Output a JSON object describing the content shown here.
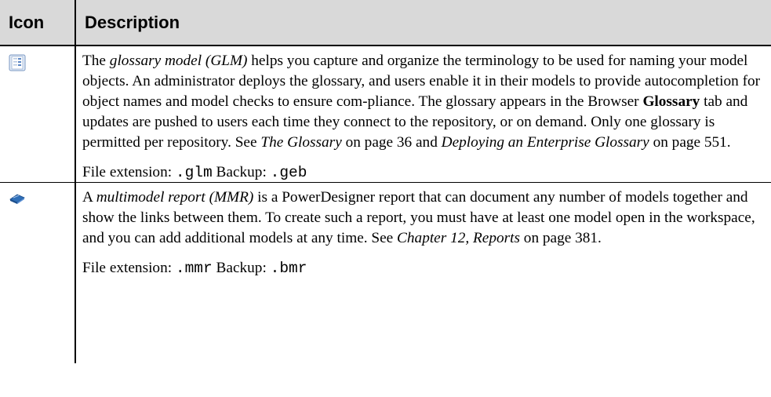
{
  "table": {
    "headers": {
      "icon": "Icon",
      "description": "Description"
    },
    "rows": [
      {
        "icon": "glossary-model-icon",
        "seg": [
          "The ",
          "glossary model (GLM)",
          " helps you capture and organize the terminology to be used for naming your model objects. An administrator deploys the glossary, and users enable it in their models to provide autocompletion for object names and model checks to ensure com-pliance. The glossary appears in the Browser ",
          "Glossary",
          " tab and updates are pushed to users each time they connect to the repository, or on demand. Only one glossary is permitted per repository. See ",
          "The Glossary",
          " on page 36 and ",
          "Deploying an Enterprise Glossary",
          " on page 551."
        ],
        "file_extension_label": "File extension:",
        "file_extension": ".glm",
        "backup_label": "Backup:",
        "backup_extension": ".geb"
      },
      {
        "icon": "multimodel-report-icon",
        "seg": [
          "A ",
          "multimodel report (MMR)",
          " is a PowerDesigner report that can document any number of models together and show the links between them. To create such a report, you must have at least one model open in the workspace, and you can add additional models at any time. See ",
          "Chapter 12, Reports",
          " on page 381."
        ],
        "file_extension_label": "File extension:",
        "file_extension": ".mmr",
        "backup_label": "Backup:",
        "backup_extension": ".bmr"
      }
    ]
  },
  "colors": {
    "header_bg": "#d9d9d9",
    "rule": "#000000",
    "glm_icon_blue": "#5a86c4",
    "mmr_icon_blue": "#2f6fb8"
  }
}
